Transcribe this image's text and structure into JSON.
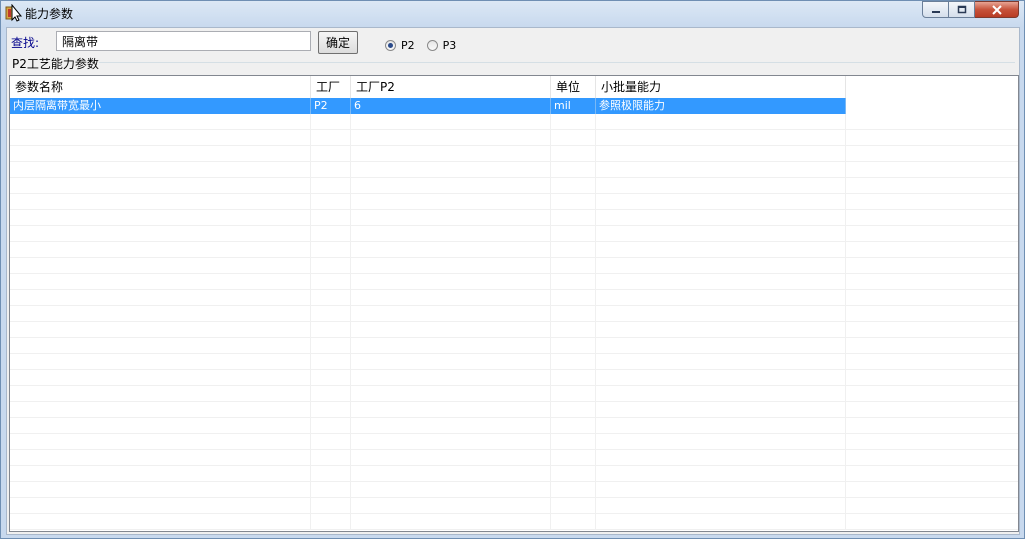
{
  "window": {
    "title": "能力参数"
  },
  "search": {
    "label": "查找:",
    "value": "隔离带",
    "button_label": "确定"
  },
  "radio": {
    "options": [
      {
        "label": "P2",
        "checked": true
      },
      {
        "label": "P3",
        "checked": false
      }
    ]
  },
  "group": {
    "label": "P2工艺能力参数"
  },
  "table": {
    "columns": [
      "参数名称",
      "工厂",
      "工厂P2",
      "单位",
      "小批量能力"
    ],
    "rows": [
      {
        "name": "内层隔离带宽最小",
        "factory": "P2",
        "factory_p2": "6",
        "unit": "mil",
        "small_batch": "参照极限能力",
        "selected": true
      }
    ]
  },
  "colors": {
    "selection": "#3399ff",
    "title_bar": "#c8d9ee"
  }
}
